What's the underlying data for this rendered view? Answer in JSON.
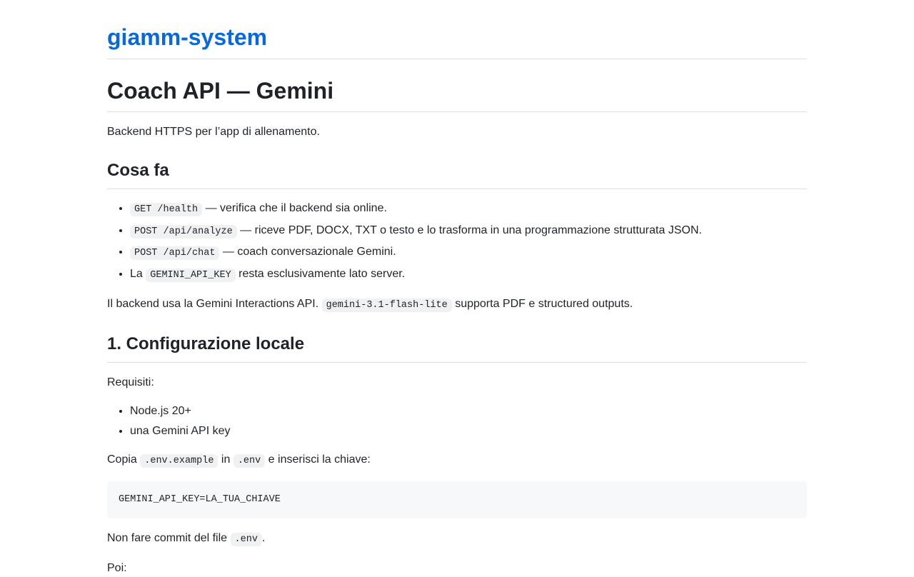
{
  "site": {
    "title": "giamm-system"
  },
  "page": {
    "title": "Coach API — Gemini",
    "intro": "Backend HTTPS per l’app di allenamento."
  },
  "section_cosa_fa": {
    "heading": "Cosa fa",
    "items": [
      {
        "code": "GET /health",
        "text": " — verifica che il backend sia online."
      },
      {
        "code": "POST /api/analyze",
        "text": " — riceve PDF, DOCX, TXT o testo e lo trasforma in una programmazione strutturata JSON."
      },
      {
        "code": "POST /api/chat",
        "text": " — coach conversazionale Gemini."
      },
      {
        "prefix": "La ",
        "code": "GEMINI_API_KEY",
        "text": " resta esclusivamente lato server."
      }
    ],
    "note_before": "Il backend usa la Gemini Interactions API. ",
    "note_code": "gemini-3.1-flash-lite",
    "note_after": " supporta PDF e structured outputs."
  },
  "section_config": {
    "heading": "1. Configurazione locale",
    "requisiti_label": "Requisiti:",
    "requisiti": [
      "Node.js 20+",
      "una Gemini API key"
    ],
    "copy_before": "Copia ",
    "copy_code1": ".env.example",
    "copy_middle": " in ",
    "copy_code2": ".env",
    "copy_after": " e inserisci la chiave:",
    "code_block": "GEMINI_API_KEY=LA_TUA_CHIAVE",
    "commit_before": "Non fare commit del file ",
    "commit_code": ".env",
    "commit_after": ".",
    "poi": "Poi:"
  }
}
